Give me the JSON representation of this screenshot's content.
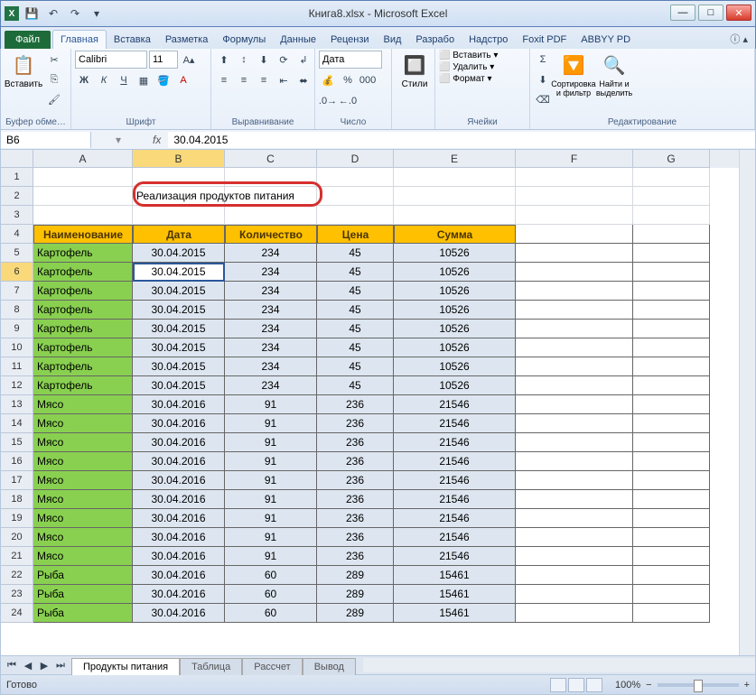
{
  "title": "Книга8.xlsx - Microsoft Excel",
  "tabs": {
    "file": "Файл",
    "home": "Главная",
    "insert": "Вставка",
    "layout": "Разметка",
    "formulas": "Формулы",
    "data": "Данные",
    "review": "Рецензи",
    "view": "Вид",
    "dev": "Разрабо",
    "addins": "Надстро",
    "foxit": "Foxit PDF",
    "abbyy": "ABBYY PD"
  },
  "ribbon": {
    "clipboard": {
      "paste": "Вставить",
      "label": "Буфер обме…"
    },
    "font": {
      "name": "Calibri",
      "size": "11",
      "label": "Шрифт",
      "bold": "Ж",
      "italic": "К",
      "underline": "Ч"
    },
    "align": {
      "label": "Выравнивание"
    },
    "number": {
      "fmt": "Дата",
      "label": "Число"
    },
    "styles": {
      "btn": "Стили"
    },
    "cells": {
      "insert": "Вставить",
      "delete": "Удалить",
      "format": "Формат",
      "label": "Ячейки"
    },
    "editing": {
      "sort": "Сортировка и фильтр",
      "find": "Найти и выделить",
      "label": "Редактирование"
    }
  },
  "namebox": "B6",
  "formula": "30.04.2015",
  "columns": [
    "A",
    "B",
    "C",
    "D",
    "E",
    "F",
    "G"
  ],
  "titlecell": "Реализация продуктов питания",
  "headers": [
    "Наименование",
    "Дата",
    "Количество",
    "Цена",
    "Сумма"
  ],
  "rows": [
    [
      "Картофель",
      "30.04.2015",
      "234",
      "45",
      "10526"
    ],
    [
      "Картофель",
      "30.04.2015",
      "234",
      "45",
      "10526"
    ],
    [
      "Картофель",
      "30.04.2015",
      "234",
      "45",
      "10526"
    ],
    [
      "Картофель",
      "30.04.2015",
      "234",
      "45",
      "10526"
    ],
    [
      "Картофель",
      "30.04.2015",
      "234",
      "45",
      "10526"
    ],
    [
      "Картофель",
      "30.04.2015",
      "234",
      "45",
      "10526"
    ],
    [
      "Картофель",
      "30.04.2015",
      "234",
      "45",
      "10526"
    ],
    [
      "Картофель",
      "30.04.2015",
      "234",
      "45",
      "10526"
    ],
    [
      "Мясо",
      "30.04.2016",
      "91",
      "236",
      "21546"
    ],
    [
      "Мясо",
      "30.04.2016",
      "91",
      "236",
      "21546"
    ],
    [
      "Мясо",
      "30.04.2016",
      "91",
      "236",
      "21546"
    ],
    [
      "Мясо",
      "30.04.2016",
      "91",
      "236",
      "21546"
    ],
    [
      "Мясо",
      "30.04.2016",
      "91",
      "236",
      "21546"
    ],
    [
      "Мясо",
      "30.04.2016",
      "91",
      "236",
      "21546"
    ],
    [
      "Мясо",
      "30.04.2016",
      "91",
      "236",
      "21546"
    ],
    [
      "Мясо",
      "30.04.2016",
      "91",
      "236",
      "21546"
    ],
    [
      "Мясо",
      "30.04.2016",
      "91",
      "236",
      "21546"
    ],
    [
      "Рыба",
      "30.04.2016",
      "60",
      "289",
      "15461"
    ],
    [
      "Рыба",
      "30.04.2016",
      "60",
      "289",
      "15461"
    ],
    [
      "Рыба",
      "30.04.2016",
      "60",
      "289",
      "15461"
    ]
  ],
  "sheets": [
    "Продукты питания",
    "Таблица",
    "Рассчет",
    "Вывод"
  ],
  "status": "Готово",
  "zoom": "100%"
}
